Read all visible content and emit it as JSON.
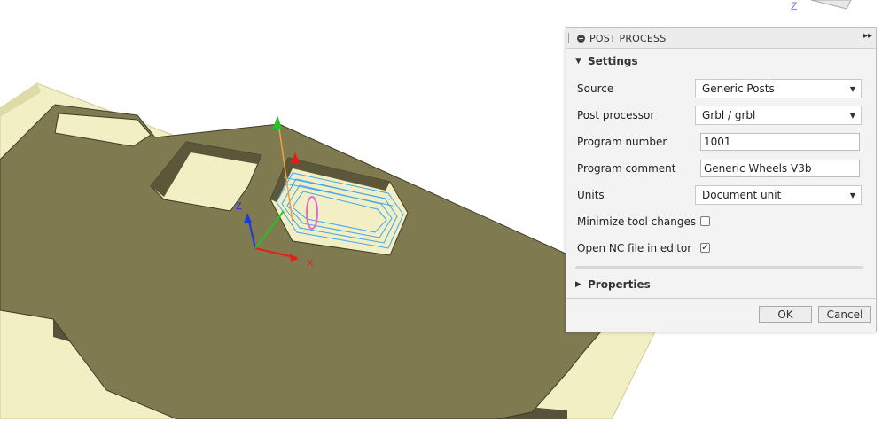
{
  "viewport": {
    "axis_labels": {
      "x": "X",
      "y": "Z",
      "viewcube": "Z"
    }
  },
  "panel": {
    "title": "POST PROCESS",
    "more_glyph": "▸▸",
    "settings_label": "Settings",
    "fields": {
      "source": {
        "label": "Source",
        "value": "Generic Posts"
      },
      "post_processor": {
        "label": "Post processor",
        "value": "Grbl / grbl"
      },
      "program_number": {
        "label": "Program number",
        "value": "1001"
      },
      "program_comment": {
        "label": "Program comment",
        "value": "Generic Wheels V3b"
      },
      "units": {
        "label": "Units",
        "value": "Document unit"
      },
      "minimize_tool_changes": {
        "label": "Minimize tool changes",
        "checked": false
      },
      "open_nc_file": {
        "label": "Open NC file in editor",
        "checked": true
      }
    },
    "properties_label": "Properties",
    "ok_label": "OK",
    "cancel_label": "Cancel"
  },
  "icons": {
    "expanded": "triangle-down-icon",
    "collapsed": "triangle-right-icon",
    "dropdown": "caret-down-icon",
    "check": "checkmark-icon"
  },
  "colors": {
    "stock": "#f1efc3",
    "part": "#7f7a4f",
    "part_side": "#56533a",
    "toolpath": "#3fa6f2",
    "axis_x": "#e81c1c",
    "axis_y": "#22c422",
    "axis_z": "#1a3bd8"
  }
}
